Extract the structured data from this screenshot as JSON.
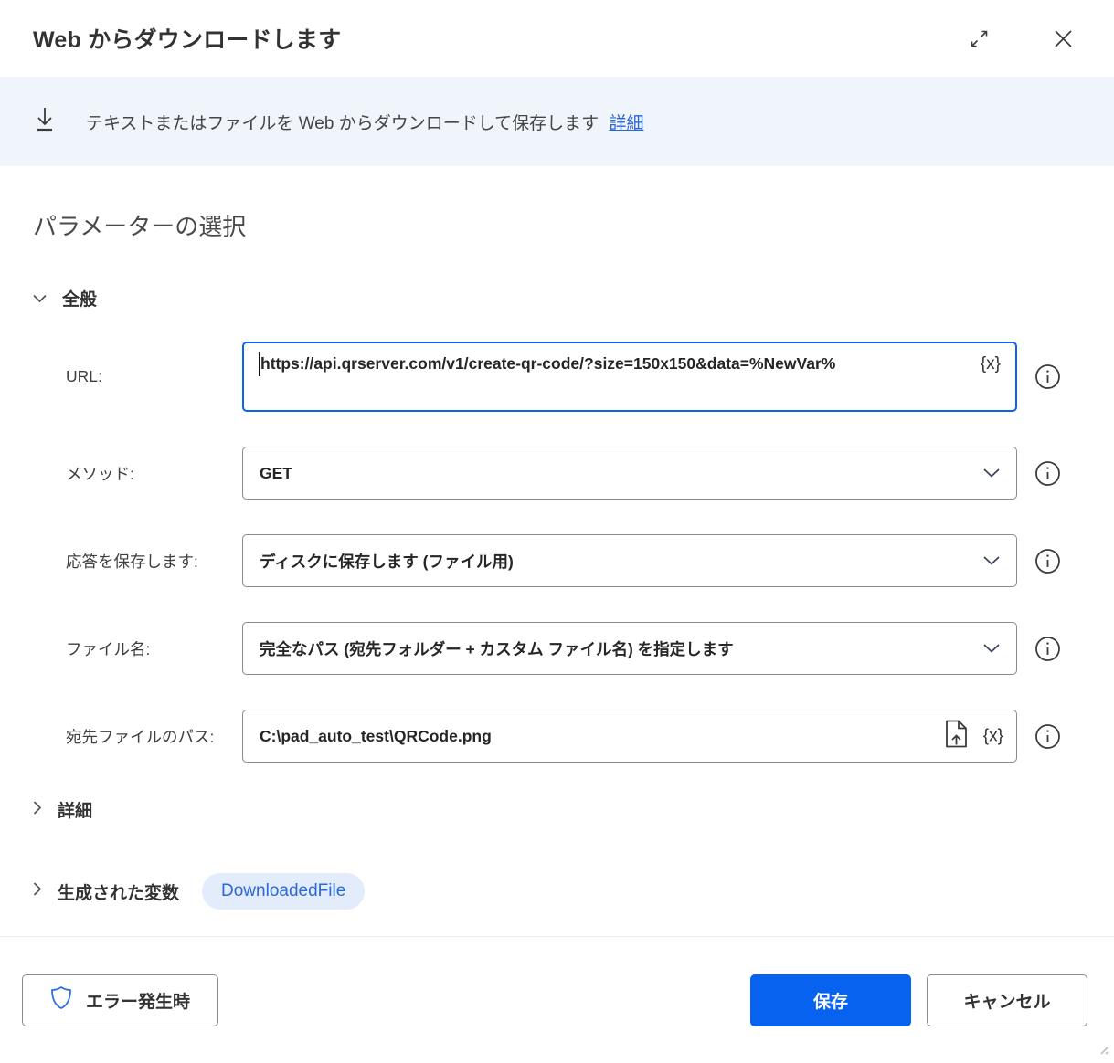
{
  "dialog": {
    "title": "Web からダウンロードします"
  },
  "banner": {
    "description": "テキストまたはファイルを Web からダウンロードして保存します",
    "link_label": "詳細"
  },
  "params": {
    "heading": "パラメーターの選択",
    "general_section_label": "全般"
  },
  "fields": [
    {
      "label": "URL:",
      "value": "https://api.qrserver.com/v1/create-qr-code/?size=150x150&data=%NewVar%"
    },
    {
      "label": "メソッド:",
      "value": "GET"
    },
    {
      "label": "応答を保存します:",
      "value": "ディスクに保存します (ファイル用)"
    },
    {
      "label": "ファイル名:",
      "value": "完全なパス (宛先フォルダー + カスタム ファイル名) を指定します"
    },
    {
      "label": "宛先ファイルのパス:",
      "value": "C:\\pad_auto_test\\QRCode.png"
    }
  ],
  "sections": {
    "advanced_label": "詳細",
    "variables_label": "生成された変数",
    "variable_pill": "DownloadedFile"
  },
  "footer": {
    "on_error_label": "エラー発生時",
    "save_label": "保存",
    "cancel_label": "キャンセル"
  },
  "icons": {
    "variable_picker_glyph": "{x}"
  },
  "colors": {
    "accent_blue": "#0862f0",
    "banner_background": "#f0f4fb",
    "link_blue": "#2966d8",
    "pill_background": "#e3ecfb",
    "pill_text": "#2a69d8",
    "focused_border": "#0f62f0",
    "control_border": "#8a8a8a"
  }
}
